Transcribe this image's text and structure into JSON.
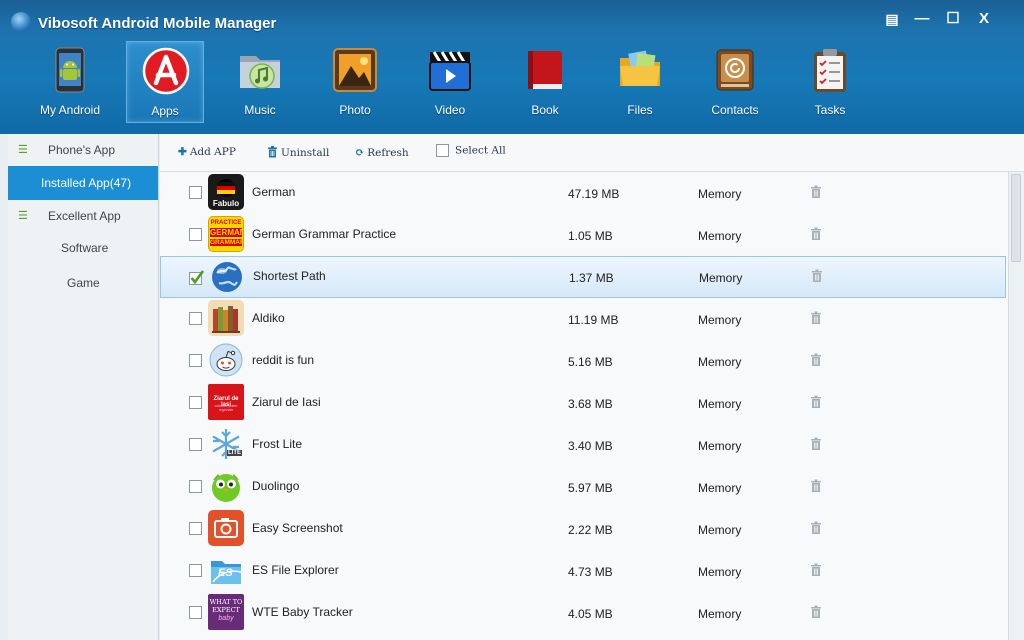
{
  "window": {
    "title": "Vibosoft Android Mobile Manager",
    "controls": {
      "settings": "▤",
      "minimize": "—",
      "maximize": "☐",
      "close": "X"
    }
  },
  "nav": {
    "items": [
      {
        "label": "My Android",
        "icon": "android-phone-icon"
      },
      {
        "label": "Apps",
        "icon": "app-store-icon",
        "active": true
      },
      {
        "label": "Music",
        "icon": "music-folder-icon"
      },
      {
        "label": "Photo",
        "icon": "photo-icon"
      },
      {
        "label": "Video",
        "icon": "clapperboard-icon"
      },
      {
        "label": "Book",
        "icon": "book-icon"
      },
      {
        "label": "Files",
        "icon": "folder-icon"
      },
      {
        "label": "Contacts",
        "icon": "contacts-icon"
      },
      {
        "label": "Tasks",
        "icon": "clipboard-icon"
      }
    ]
  },
  "sidebar": {
    "items": [
      {
        "label": "Phone's App"
      },
      {
        "label": "Installed App(47)"
      },
      {
        "label": "Excellent App"
      },
      {
        "label": "Software"
      },
      {
        "label": "Game"
      }
    ]
  },
  "toolbar": {
    "add_label": "Add APP",
    "uninstall_label": "Uninstall",
    "refresh_label": "Refresh",
    "select_all_label": "Select All"
  },
  "apps": [
    {
      "name": "German",
      "size": "47.19 MB",
      "location": "Memory",
      "checked": false
    },
    {
      "name": "German Grammar Practice",
      "size": "1.05 MB",
      "location": "Memory",
      "checked": false
    },
    {
      "name": "Shortest Path",
      "size": "1.37 MB",
      "location": "Memory",
      "checked": true
    },
    {
      "name": "Aldiko",
      "size": "11.19 MB",
      "location": "Memory",
      "checked": false
    },
    {
      "name": "reddit is fun",
      "size": "5.16 MB",
      "location": "Memory",
      "checked": false
    },
    {
      "name": "Ziarul de Iasi",
      "size": "3.68 MB",
      "location": "Memory",
      "checked": false
    },
    {
      "name": "Frost Lite",
      "size": "3.40 MB",
      "location": "Memory",
      "checked": false
    },
    {
      "name": "Duolingo",
      "size": "5.97 MB",
      "location": "Memory",
      "checked": false
    },
    {
      "name": "Easy Screenshot",
      "size": "2.22 MB",
      "location": "Memory",
      "checked": false
    },
    {
      "name": "ES File Explorer",
      "size": "4.73 MB",
      "location": "Memory",
      "checked": false
    },
    {
      "name": "WTE Baby Tracker",
      "size": "4.05 MB",
      "location": "Memory",
      "checked": false
    }
  ],
  "icon_text": {
    "german": "Fabulo",
    "grammar": [
      "PRACTICE",
      "GERMAN",
      "GRAMMAR"
    ],
    "ziarul": [
      "Ziarul de Iasi",
      "cotidian, puteri regionale"
    ],
    "frost": "LITE",
    "es": "ES",
    "wte": [
      "WHAT TO",
      "EXPECT",
      "baby"
    ]
  },
  "colors": {
    "accent": "#1c8fd4",
    "header": "#1779b7",
    "check": "#4aa020"
  }
}
